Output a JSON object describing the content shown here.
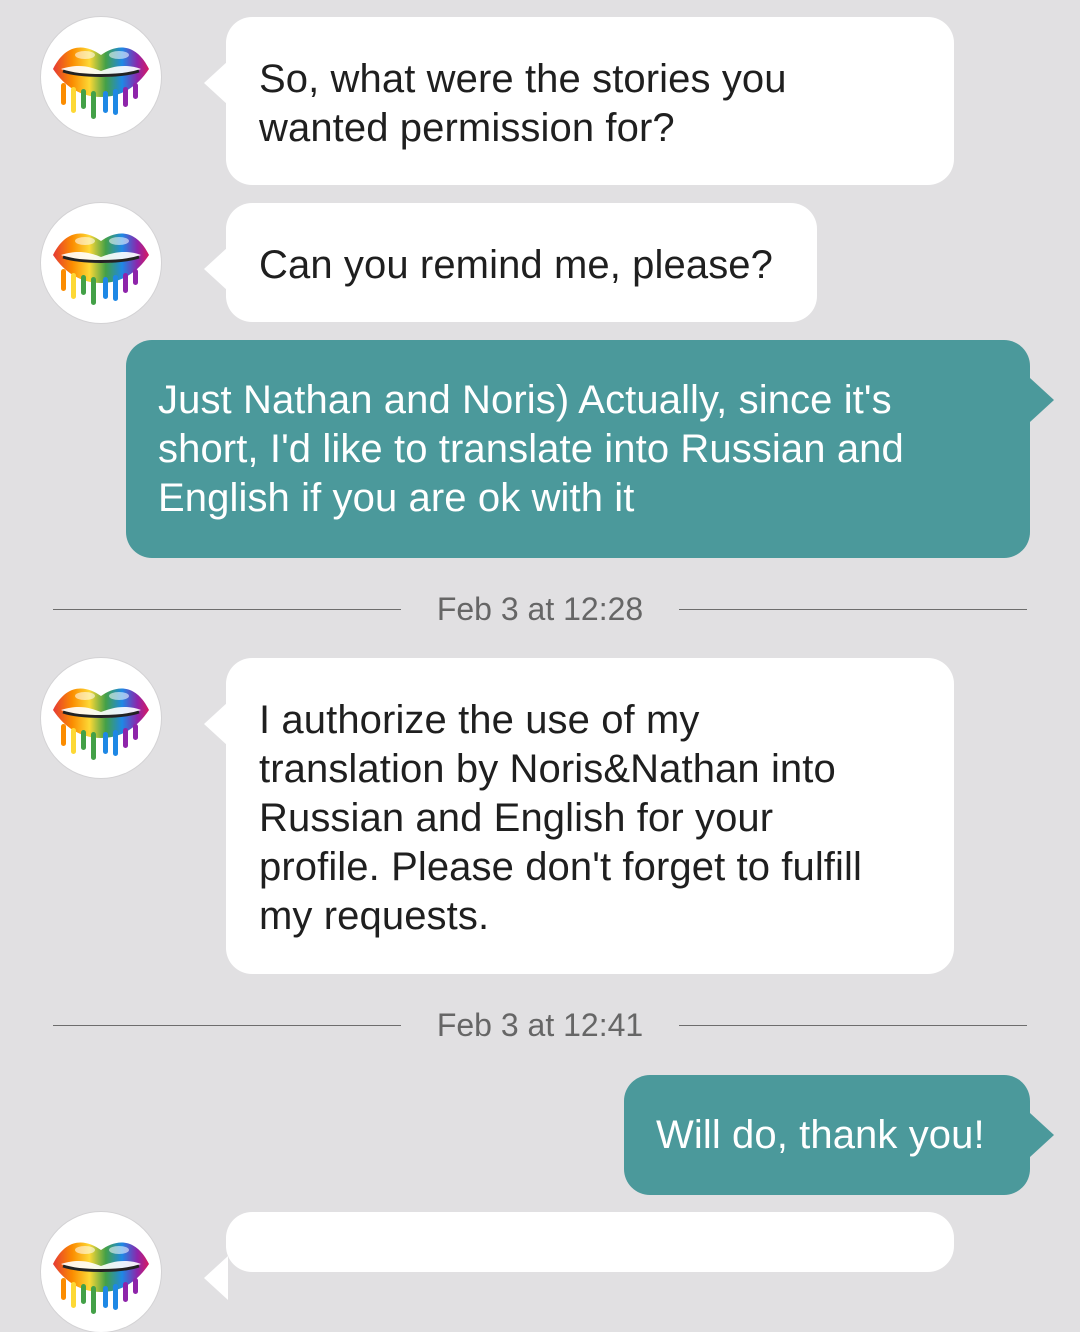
{
  "conversation": {
    "messages": [
      {
        "direction": "incoming",
        "text": "So, what were the stories you\nwanted permission for?"
      },
      {
        "direction": "incoming",
        "text": "Can you remind me, please?"
      },
      {
        "direction": "outgoing",
        "text": "Just Nathan and Noris) Actually, since it's\nshort, I'd like to translate into Russian and\nEnglish if you are ok with it"
      },
      {
        "direction": "incoming",
        "text": "I authorize the use of my\ntranslation by Noris&Nathan into\nRussian and English for your\nprofile. Please don't forget to fulfill\nmy requests."
      },
      {
        "direction": "outgoing",
        "text": "Will do, thank you!"
      }
    ],
    "separators": [
      {
        "label": "Feb 3 at 12:28"
      },
      {
        "label": "Feb 3 at 12:41"
      }
    ]
  },
  "colors": {
    "background": "#e1e0e2",
    "incoming_bubble": "#ffffff",
    "outgoing_bubble": "#4b999b",
    "outgoing_text": "#ffffff",
    "incoming_text": "#1f1f1f"
  },
  "icons": {
    "avatar": "rainbow-lips-avatar"
  }
}
